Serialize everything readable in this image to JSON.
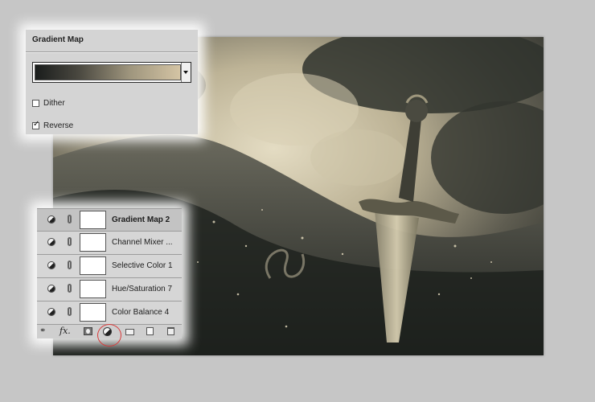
{
  "gradient_map": {
    "title": "Gradient Map",
    "gradient_colors": [
      "#1a1d1c",
      "#4a4840",
      "#9e957d",
      "#d4c4a4"
    ],
    "dither": {
      "label": "Dither",
      "checked": false
    },
    "reverse": {
      "label": "Reverse",
      "checked": true
    }
  },
  "layers": {
    "items": [
      {
        "name": "Gradient Map 2",
        "selected": true
      },
      {
        "name": "Channel Mixer ...",
        "selected": false
      },
      {
        "name": "Selective Color 1",
        "selected": false
      },
      {
        "name": "Hue/Saturation 7",
        "selected": false
      },
      {
        "name": "Color Balance 4",
        "selected": false
      }
    ],
    "footer": {
      "link_icon": "link-layers-icon",
      "fx_label": "fx.",
      "mask_icon": "add-mask-icon",
      "adjustment_icon": "new-adjustment-layer-icon",
      "group_icon": "folder-icon",
      "new_layer_icon": "new-layer-icon",
      "delete_icon": "trash-icon"
    }
  },
  "colors": {
    "highlight": "#d83b3b",
    "sepia_light": "#d7ccae",
    "sepia_dark": "#252824"
  }
}
